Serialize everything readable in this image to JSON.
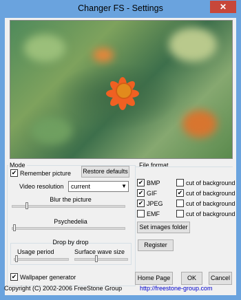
{
  "window": {
    "title": "Changer FS - Settings",
    "close_label": "✕"
  },
  "mode": {
    "group_label": "Mode",
    "remember_picture_label": "Remember picture",
    "remember_picture_checked": true,
    "restore_defaults_label": "Restore defaults",
    "video_resolution_label": "Video resolution",
    "video_resolution_value": "current",
    "blur_label": "Blur the picture",
    "blur_level": 0.11,
    "psychedelia_label": "Psychedelia",
    "psychedelia_level": 0.0,
    "drop_by_drop_label": "Drop by drop",
    "usage_period_label": "Usage period",
    "usage_period_level": 0.0,
    "surface_wave_label": "Surface wave size",
    "surface_wave_level": 0.4,
    "wallpaper_generator_label": "Wallpaper generator",
    "wallpaper_generator_checked": true
  },
  "file_format": {
    "group_label": "File format",
    "formats": [
      {
        "label": "BMP",
        "checked": true,
        "cut_label": "cut of background",
        "cut_checked": false
      },
      {
        "label": "GIF",
        "checked": true,
        "cut_label": "cut of background",
        "cut_checked": true
      },
      {
        "label": "JPEG",
        "checked": true,
        "cut_label": "cut of background",
        "cut_checked": false
      },
      {
        "label": "EMF",
        "checked": false,
        "cut_label": "cut of background",
        "cut_checked": false
      }
    ],
    "set_images_folder_label": "Set images  folder",
    "register_label": "Register"
  },
  "buttons": {
    "home_page": "Home Page",
    "ok": "OK",
    "cancel": "Cancel"
  },
  "footer": {
    "copyright": "Copyright (C) 2002-2006 FreeStone Group",
    "url": "http://freestone-group.com"
  },
  "colors": {
    "titlebar": "#6aa3de",
    "close": "#c7473a",
    "flower": "#f06022"
  }
}
